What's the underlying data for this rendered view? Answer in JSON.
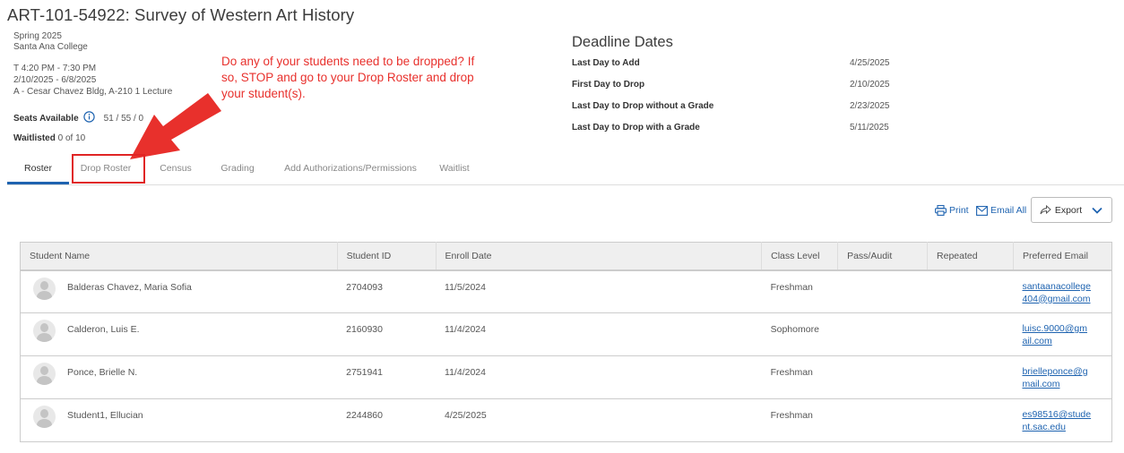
{
  "course": {
    "title": "ART-101-54922: Survey of Western Art History",
    "term": "Spring 2025",
    "college": "Santa Ana College",
    "time": "T 4:20 PM - 7:30 PM",
    "dates": "2/10/2025 - 6/8/2025",
    "location": "A - Cesar Chavez Bldg, A-210 1 Lecture",
    "seats_label": "Seats Available",
    "seats_value": "51 / 55 / 0",
    "waitlisted_label": "Waitlisted",
    "waitlisted_value": "0 of 10"
  },
  "deadlines": {
    "title": "Deadline Dates",
    "rows": [
      {
        "label": "Last Day to Add",
        "value": "4/25/2025"
      },
      {
        "label": "First Day to Drop",
        "value": "2/10/2025"
      },
      {
        "label": "Last Day to Drop without a Grade",
        "value": "2/23/2025"
      },
      {
        "label": "Last Day to Drop with a Grade",
        "value": "5/11/2025"
      }
    ]
  },
  "callout": "Do any of your students need to be dropped? If so, STOP and go to your Drop Roster and drop your student(s).",
  "tabs": [
    {
      "label": "Roster",
      "active": true
    },
    {
      "label": "Drop Roster"
    },
    {
      "label": "Census"
    },
    {
      "label": "Grading"
    },
    {
      "label": "Add Authorizations/Permissions"
    },
    {
      "label": "Waitlist"
    }
  ],
  "actions": {
    "print": "Print",
    "email_all": "Email All",
    "export": "Export"
  },
  "table": {
    "headers": [
      "Student Name",
      "Student ID",
      "Enroll Date",
      "Class Level",
      "Pass/Audit",
      "Repeated",
      "Preferred Email"
    ],
    "rows": [
      {
        "name": "Balderas Chavez, Maria Sofia",
        "id": "2704093",
        "enroll": "11/5/2024",
        "level": "Freshman",
        "pass": "",
        "repeated": "",
        "email": "santaanacollege404@gmail.com"
      },
      {
        "name": "Calderon, Luis E.",
        "id": "2160930",
        "enroll": "11/4/2024",
        "level": "Sophomore",
        "pass": "",
        "repeated": "",
        "email": "luisc.9000@gmail.com"
      },
      {
        "name": "Ponce, Brielle N.",
        "id": "2751941",
        "enroll": "11/4/2024",
        "level": "Freshman",
        "pass": "",
        "repeated": "",
        "email": "brielleponce@gmail.com"
      },
      {
        "name": "Student1, Ellucian",
        "id": "2244860",
        "enroll": "4/25/2025",
        "level": "Freshman",
        "pass": "",
        "repeated": "",
        "email": "es98516@student.sac.edu"
      }
    ]
  },
  "colors": {
    "accent": "#1e63b0",
    "callout": "#e8302c",
    "highlight": "#e02424"
  }
}
